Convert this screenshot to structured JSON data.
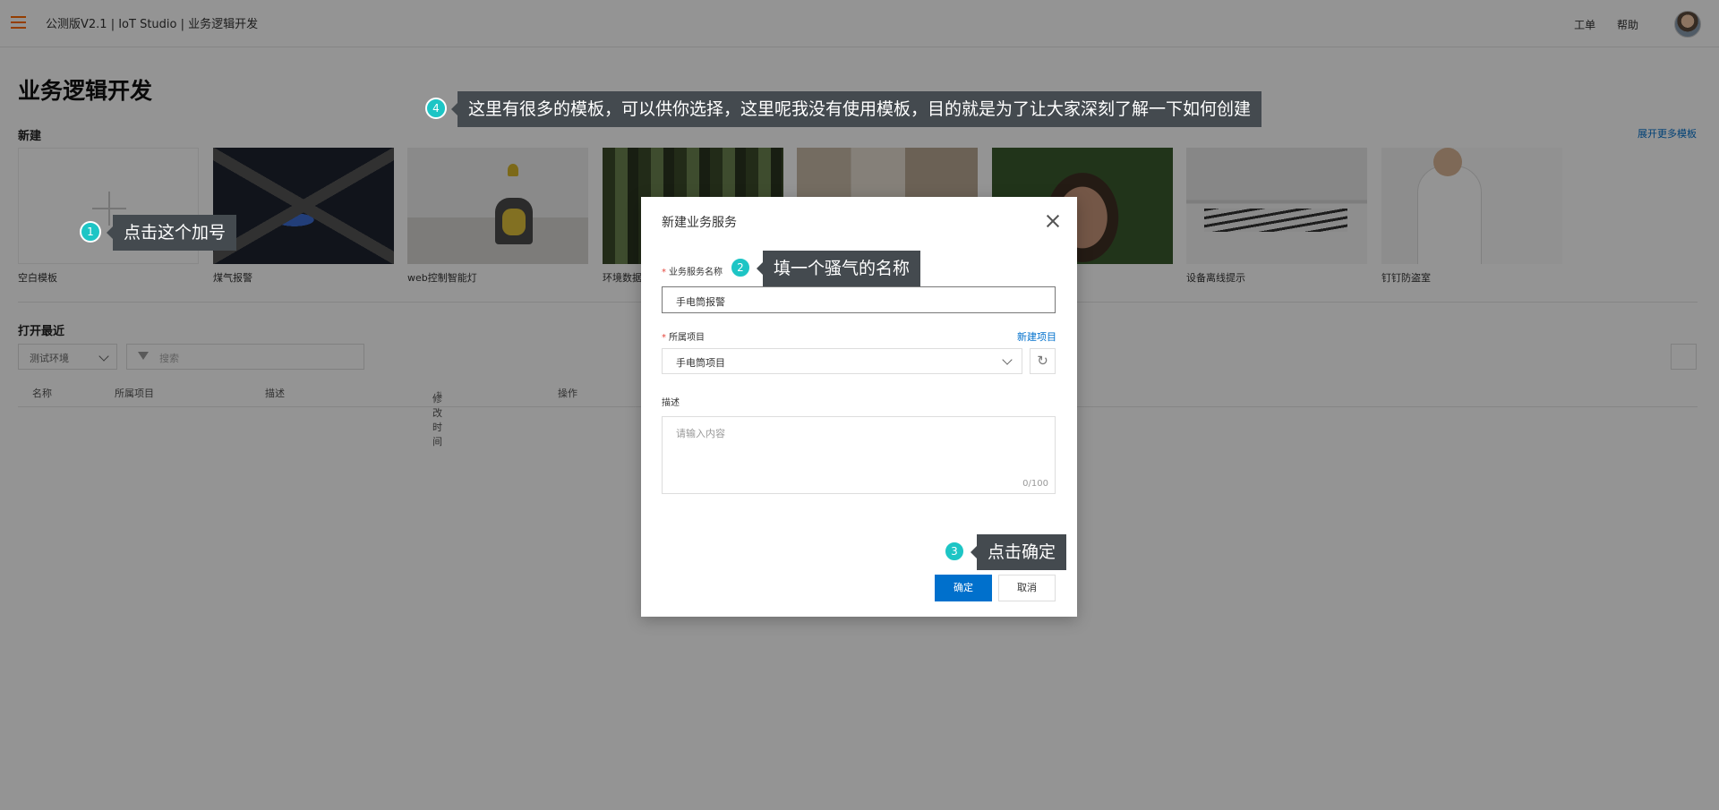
{
  "header": {
    "breadcrumb": "公测版V2.1 | IoT Studio | 业务逻辑开发",
    "links": [
      "工单",
      "帮助"
    ]
  },
  "page": {
    "title": "业务逻辑开发",
    "section_new": "新建",
    "more_templates": "展开更多模板",
    "section_recent": "打开最近"
  },
  "templates": [
    {
      "label": "空白模板"
    },
    {
      "label": "煤气报警"
    },
    {
      "label": "web控制智能灯"
    },
    {
      "label": "环境数据"
    },
    {
      "label": ""
    },
    {
      "label": ""
    },
    {
      "label": "设备离线提示"
    },
    {
      "label": "钉钉防盗室"
    }
  ],
  "filters": {
    "env": "测试环境",
    "search_placeholder": "搜索"
  },
  "table": {
    "columns": [
      "名称",
      "所属项目",
      "描述",
      "修改时间",
      "操作"
    ]
  },
  "modal": {
    "title": "新建业务服务",
    "name_label": "业务服务名称",
    "name_value": "手电筒报警",
    "project_label": "所属项目",
    "new_project": "新建项目",
    "project_value": "手电筒项目",
    "desc_label": "描述",
    "desc_placeholder": "请输入内容",
    "desc_count": "0/100",
    "ok": "确定",
    "cancel": "取消"
  },
  "callouts": [
    {
      "num": "1",
      "text": "点击这个加号"
    },
    {
      "num": "2",
      "text": "填一个骚气的名称"
    },
    {
      "num": "3",
      "text": "点击确定"
    },
    {
      "num": "4",
      "text": "这里有很多的模板，可以供你选择，这里呢我没有使用模板，目的就是为了让大家深刻了解一下如何创建"
    }
  ],
  "colors": {
    "accent": "#0070cc",
    "brand_orange": "#ff6a00",
    "callout_badge": "#1dc5c5",
    "callout_bg": "#444a4f"
  }
}
